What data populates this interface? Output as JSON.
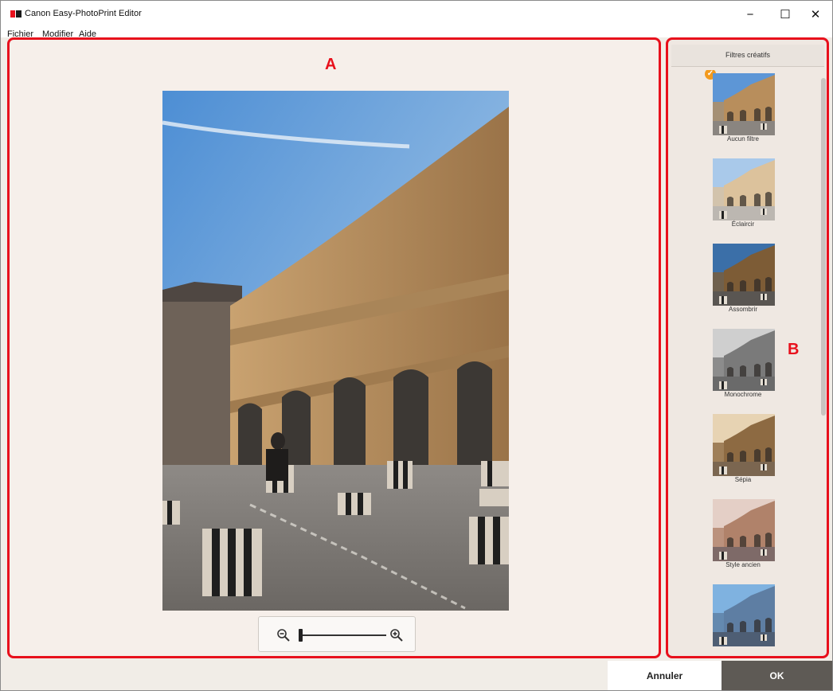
{
  "window": {
    "title": "Canon Easy-PhotoPrint Editor",
    "controls": {
      "minimize": "−",
      "maximize": "☐",
      "close": "✕"
    }
  },
  "menu": [
    "Fichier",
    "Modifier",
    "Aide"
  ],
  "preview": {
    "marker": "A",
    "image_icon": "photo-courtyard",
    "zoom": {
      "out_icon": "zoom-out-icon",
      "in_icon": "zoom-in-icon",
      "level": 0
    }
  },
  "filters_panel": {
    "marker": "B",
    "title": "Filtres créatifs",
    "items": [
      {
        "label": "Aucun filtre",
        "selected": true,
        "variant": "none"
      },
      {
        "label": "Éclaircir",
        "selected": false,
        "variant": "lighten"
      },
      {
        "label": "Assombrir",
        "selected": false,
        "variant": "darken"
      },
      {
        "label": "Monochrome",
        "selected": false,
        "variant": "mono"
      },
      {
        "label": "Sépia",
        "selected": false,
        "variant": "sepia"
      },
      {
        "label": "Style ancien",
        "selected": false,
        "variant": "vintage"
      },
      {
        "label": "",
        "selected": false,
        "variant": "cool"
      }
    ]
  },
  "buttons": {
    "cancel": "Annuler",
    "ok": "OK"
  },
  "colors": {
    "highlight": "#e8101c",
    "check": "#f39a1d",
    "ok_button": "#5e5a55"
  }
}
